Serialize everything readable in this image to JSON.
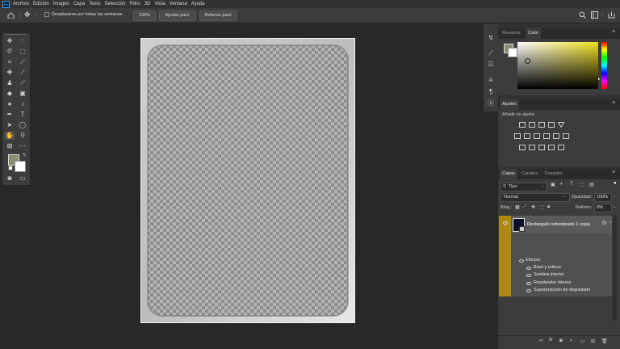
{
  "app": {
    "logo": "Ps"
  },
  "menu": [
    "Archivo",
    "Edición",
    "Imagen",
    "Capa",
    "Texto",
    "Selección",
    "Filtro",
    "3D",
    "Vista",
    "Ventana",
    "Ayuda"
  ],
  "options": {
    "scroll_all_label": "Desplazarse por todas las ventanas",
    "zoom_value": "100%",
    "fit_screen_label": "Ajustar pant.",
    "fill_screen_label": "Rellenar pant."
  },
  "swatches_panel": {
    "tabs": [
      "Muestras",
      "Color"
    ],
    "active_tab": "Color"
  },
  "adjustments_panel": {
    "title": "Ajustes",
    "subtitle": "Añadir un ajuste"
  },
  "layers_panel": {
    "tabs": [
      "Capas",
      "Canales",
      "Trazados"
    ],
    "filter_kind": "Tipo",
    "blend_mode": "Normal",
    "opacity_label": "Opacidad:",
    "opacity_value": "100%",
    "lock_label": "Bloq.:",
    "fill_label": "Relleno:",
    "fill_value": "0%",
    "layer_name": "Rectángulo redondeado 1 copia",
    "fx_label": "fx",
    "effects_label": "Efectos",
    "effects": [
      "Bisel y relieve",
      "Sombra interior",
      "Resplandor interior",
      "Superposición de degradado"
    ]
  },
  "colors": {
    "app_bg": "#282828",
    "panel_bg": "#3c3c3c",
    "layer_highlight": "#b08a10",
    "color_field_hue": "#f0e020",
    "foreground_swatch": "#8a8c70",
    "background_swatch": "#ffffff"
  },
  "icons": [
    "home-icon",
    "move-tool-icon",
    "marquee-tool-icon",
    "lasso-tool-icon",
    "crop-tool-icon",
    "eyedropper-icon",
    "healing-brush-icon",
    "brush-icon",
    "stamp-icon",
    "history-brush-icon",
    "eraser-icon",
    "gradient-icon",
    "blur-icon",
    "dodge-icon",
    "pen-icon",
    "type-icon",
    "path-select-icon",
    "shape-icon",
    "hand-icon",
    "zoom-icon",
    "search-icon",
    "eye-icon",
    "trash-icon"
  ]
}
